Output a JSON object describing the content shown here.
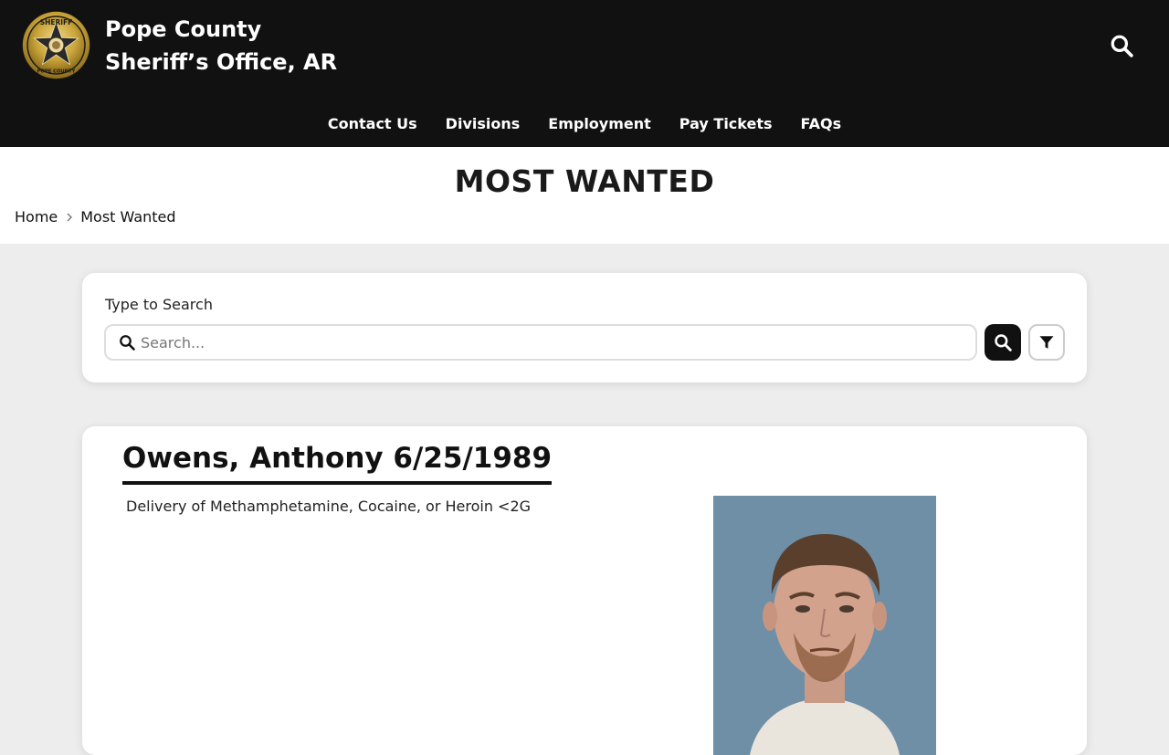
{
  "header": {
    "title_line1": "Pope County",
    "title_line2": "Sheriff’s Office, AR",
    "logo_text_top": "SHERIFF",
    "logo_text_bottom": "POPE COUNTY",
    "search_icon": "search-icon"
  },
  "nav": {
    "items": [
      {
        "label": "Contact Us"
      },
      {
        "label": "Divisions"
      },
      {
        "label": "Employment"
      },
      {
        "label": "Pay Tickets"
      },
      {
        "label": "FAQs"
      }
    ]
  },
  "page": {
    "title": "MOST WANTED"
  },
  "breadcrumb": {
    "home": "Home",
    "current": "Most Wanted",
    "separator_icon": "chevron-right-icon"
  },
  "search": {
    "label": "Type to Search",
    "placeholder": "Search...",
    "value": "",
    "search_button_icon": "search-icon",
    "filter_button_icon": "filter-icon"
  },
  "result": {
    "name": "Owens, Anthony 6/25/1989",
    "charge": "Delivery of Methamphetamine, Cocaine, or Heroin <2G"
  },
  "colors": {
    "header_bg": "#111111",
    "page_bg": "#ededed",
    "card_bg": "#ffffff",
    "badge_gold": "#c9a43a",
    "mugshot_bg": "#6f8fa7"
  }
}
